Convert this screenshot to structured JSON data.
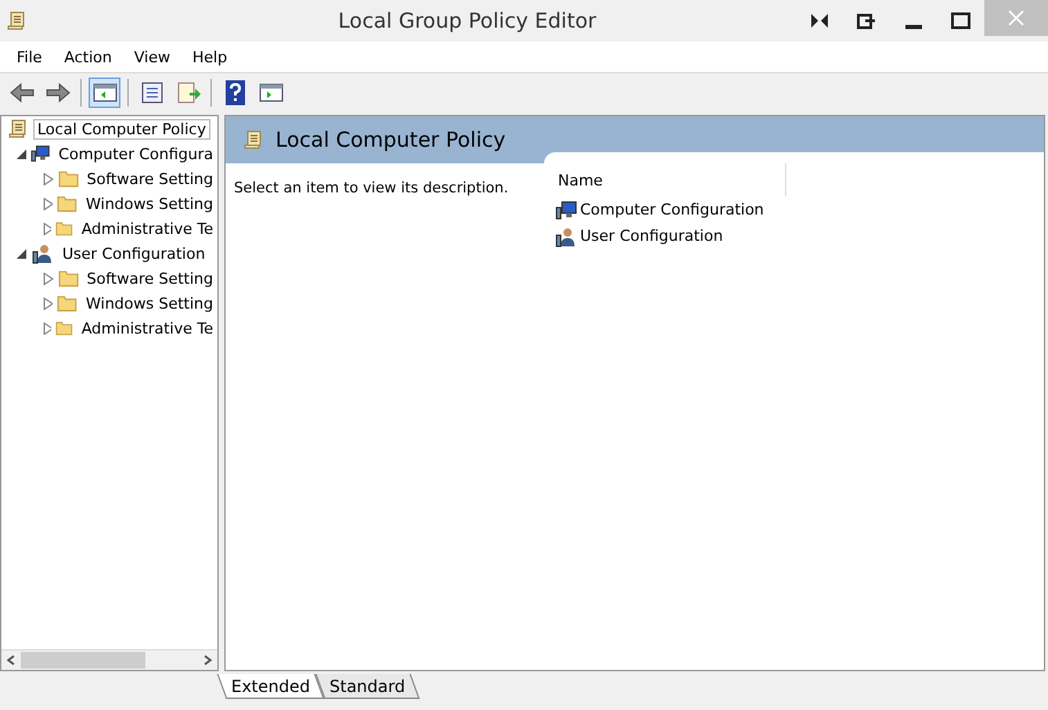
{
  "window": {
    "title": "Local Group Policy Editor"
  },
  "menu": [
    "File",
    "Action",
    "View",
    "Help"
  ],
  "toolbar": [
    {
      "kind": "back",
      "selected": false
    },
    {
      "kind": "forward",
      "selected": false
    },
    {
      "kind": "tree",
      "selected": true
    },
    {
      "kind": "properties",
      "selected": false
    },
    {
      "kind": "export",
      "selected": false
    },
    {
      "kind": "help",
      "selected": false
    },
    {
      "kind": "pane",
      "selected": false
    }
  ],
  "tree": [
    {
      "label": "Local Computer Policy",
      "kind": "policy",
      "selected": true,
      "children": [
        {
          "label": "Computer Configura",
          "kind": "computer",
          "expanded": true,
          "selected": false,
          "children": [
            {
              "label": "Software Setting",
              "kind": "folder",
              "expanded": false,
              "selected": false
            },
            {
              "label": "Windows Setting",
              "kind": "folder",
              "expanded": false,
              "selected": false
            },
            {
              "label": "Administrative Te",
              "kind": "folder",
              "expanded": false,
              "selected": false
            }
          ]
        },
        {
          "label": "User Configuration",
          "kind": "user",
          "expanded": true,
          "selected": false,
          "children": [
            {
              "label": "Software Setting",
              "kind": "folder",
              "expanded": false,
              "selected": false
            },
            {
              "label": "Windows Setting",
              "kind": "folder",
              "expanded": false,
              "selected": false
            },
            {
              "label": "Administrative Te",
              "kind": "folder",
              "expanded": false,
              "selected": false
            }
          ]
        }
      ]
    }
  ],
  "header": {
    "title": "Local Computer Policy"
  },
  "description": "Select an item to view its description.",
  "list": {
    "columns": [
      "Name"
    ],
    "rows": [
      {
        "name": "Computer Configuration",
        "kind": "computer"
      },
      {
        "name": "User Configuration",
        "kind": "user"
      }
    ]
  },
  "tabs": [
    {
      "label": "Extended",
      "selected": true
    },
    {
      "label": "Standard",
      "selected": false
    }
  ]
}
